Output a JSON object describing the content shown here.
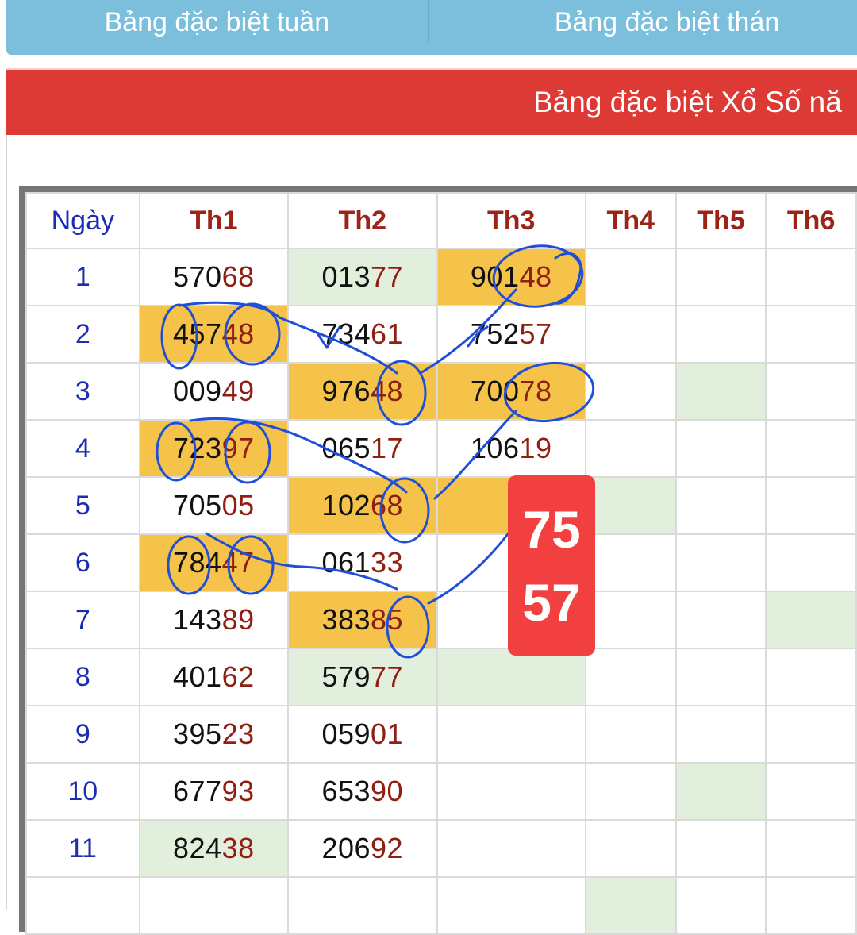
{
  "tabs": [
    "Bảng đặc biệt tuần",
    "Bảng đặc biệt thán"
  ],
  "banner_title": "Bảng đặc biệt Xổ Số nă",
  "table": {
    "headers": [
      "Ngày",
      "Th1",
      "Th2",
      "Th3",
      "Th4",
      "Th5",
      "Th6"
    ],
    "rows": [
      {
        "day": "1",
        "cells": [
          {
            "v": "57068",
            "bg": ""
          },
          {
            "v": "01377",
            "bg": "g"
          },
          {
            "v": "90148",
            "bg": "y"
          },
          {
            "v": "",
            "bg": ""
          },
          {
            "v": "",
            "bg": ""
          },
          {
            "v": "",
            "bg": ""
          }
        ]
      },
      {
        "day": "2",
        "cells": [
          {
            "v": "45748",
            "bg": "y"
          },
          {
            "v": "73461",
            "bg": ""
          },
          {
            "v": "75257",
            "bg": ""
          },
          {
            "v": "",
            "bg": ""
          },
          {
            "v": "",
            "bg": ""
          },
          {
            "v": "",
            "bg": ""
          }
        ]
      },
      {
        "day": "3",
        "cells": [
          {
            "v": "00949",
            "bg": ""
          },
          {
            "v": "97648",
            "bg": "y"
          },
          {
            "v": "70078",
            "bg": "y"
          },
          {
            "v": "",
            "bg": ""
          },
          {
            "v": "",
            "bg": "g"
          },
          {
            "v": "",
            "bg": ""
          }
        ]
      },
      {
        "day": "4",
        "cells": [
          {
            "v": "72397",
            "bg": "y"
          },
          {
            "v": "06517",
            "bg": ""
          },
          {
            "v": "10619",
            "bg": ""
          },
          {
            "v": "",
            "bg": ""
          },
          {
            "v": "",
            "bg": ""
          },
          {
            "v": "",
            "bg": ""
          }
        ]
      },
      {
        "day": "5",
        "cells": [
          {
            "v": "70505",
            "bg": ""
          },
          {
            "v": "10268",
            "bg": "y"
          },
          {
            "v": "",
            "bg": "y"
          },
          {
            "v": "",
            "bg": "g"
          },
          {
            "v": "",
            "bg": ""
          },
          {
            "v": "",
            "bg": ""
          }
        ]
      },
      {
        "day": "6",
        "cells": [
          {
            "v": "78447",
            "bg": "y"
          },
          {
            "v": "06133",
            "bg": ""
          },
          {
            "v": "",
            "bg": ""
          },
          {
            "v": "",
            "bg": ""
          },
          {
            "v": "",
            "bg": ""
          },
          {
            "v": "",
            "bg": ""
          }
        ]
      },
      {
        "day": "7",
        "cells": [
          {
            "v": "14389",
            "bg": ""
          },
          {
            "v": "38385",
            "bg": "y"
          },
          {
            "v": "",
            "bg": ""
          },
          {
            "v": "",
            "bg": ""
          },
          {
            "v": "",
            "bg": ""
          },
          {
            "v": "",
            "bg": "g"
          }
        ]
      },
      {
        "day": "8",
        "cells": [
          {
            "v": "40162",
            "bg": ""
          },
          {
            "v": "57977",
            "bg": "g"
          },
          {
            "v": "",
            "bg": "g"
          },
          {
            "v": "",
            "bg": ""
          },
          {
            "v": "",
            "bg": ""
          },
          {
            "v": "",
            "bg": ""
          }
        ]
      },
      {
        "day": "9",
        "cells": [
          {
            "v": "39523",
            "bg": ""
          },
          {
            "v": "05901",
            "bg": ""
          },
          {
            "v": "",
            "bg": ""
          },
          {
            "v": "",
            "bg": ""
          },
          {
            "v": "",
            "bg": ""
          },
          {
            "v": "",
            "bg": ""
          }
        ]
      },
      {
        "day": "10",
        "cells": [
          {
            "v": "67793",
            "bg": ""
          },
          {
            "v": "65390",
            "bg": ""
          },
          {
            "v": "",
            "bg": ""
          },
          {
            "v": "",
            "bg": ""
          },
          {
            "v": "",
            "bg": "g"
          },
          {
            "v": "",
            "bg": ""
          }
        ]
      },
      {
        "day": "11",
        "cells": [
          {
            "v": "82438",
            "bg": "g"
          },
          {
            "v": "20692",
            "bg": ""
          },
          {
            "v": "",
            "bg": ""
          },
          {
            "v": "",
            "bg": ""
          },
          {
            "v": "",
            "bg": ""
          },
          {
            "v": "",
            "bg": ""
          }
        ]
      },
      {
        "day": "",
        "cells": [
          {
            "v": "",
            "bg": ""
          },
          {
            "v": "",
            "bg": ""
          },
          {
            "v": "",
            "bg": ""
          },
          {
            "v": "",
            "bg": "g"
          },
          {
            "v": "",
            "bg": ""
          },
          {
            "v": "",
            "bg": ""
          }
        ]
      }
    ]
  },
  "prediction_badge": {
    "line1": "75",
    "line2": "57"
  },
  "colors": {
    "tab_bg": "#7cbfdd",
    "banner_bg": "#dd3935",
    "highlight_yellow": "#f5c24a",
    "highlight_green": "#e2efdd",
    "header_red": "#9b2417",
    "day_blue": "#1a2db0",
    "badge_red": "#f23f3f",
    "ink_blue": "#1f4fd8"
  }
}
